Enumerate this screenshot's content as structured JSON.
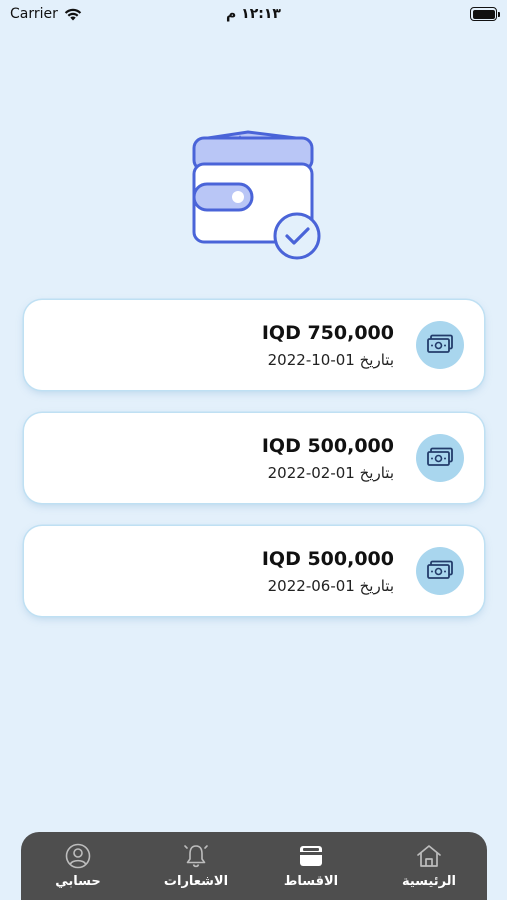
{
  "status_bar": {
    "carrier": "Carrier",
    "time": "١٢:١٣ م"
  },
  "installments": [
    {
      "amount": "IQD 750,000",
      "date_label": "بتاريخ",
      "date": "01-10-2022"
    },
    {
      "amount": "IQD 500,000",
      "date_label": "بتاريخ",
      "date": "01-02-2022"
    },
    {
      "amount": "IQD 500,000",
      "date_label": "بتاريخ",
      "date": "01-06-2022"
    }
  ],
  "tab_bar": {
    "home": "الرئيسية",
    "installments": "الاقساط",
    "notifications": "الاشعارات",
    "account": "حسابي"
  },
  "colors": {
    "background": "#e3f0fb",
    "card": "#ffffff",
    "icon_circle": "#a9d6ee",
    "wallet_accent": "#4a64d8",
    "tab_bar": "#4e4e4e"
  }
}
